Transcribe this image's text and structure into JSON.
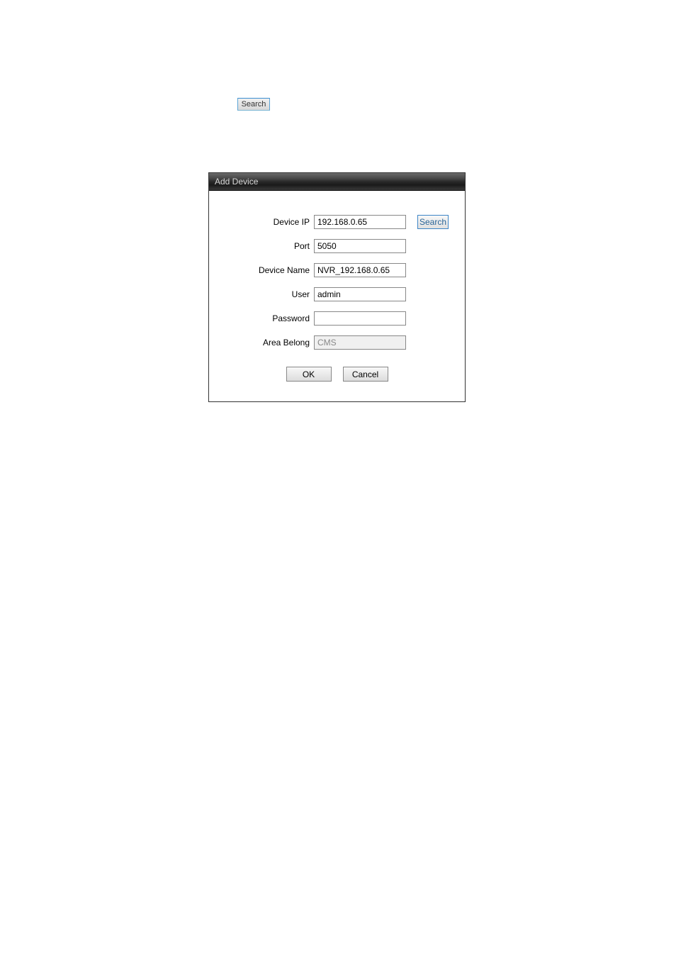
{
  "top_search_button": "Search",
  "dialog": {
    "title": "Add Device",
    "search_button": "Search",
    "fields": {
      "device_ip": {
        "label": "Device IP",
        "value": "192.168.0.65"
      },
      "port": {
        "label": "Port",
        "value": "5050"
      },
      "device_name": {
        "label": "Device Name",
        "value": "NVR_192.168.0.65"
      },
      "user": {
        "label": "User",
        "value": "admin"
      },
      "password": {
        "label": "Password",
        "value": ""
      },
      "area_belong": {
        "label": "Area Belong",
        "value": "CMS"
      }
    },
    "buttons": {
      "ok": "OK",
      "cancel": "Cancel"
    }
  }
}
